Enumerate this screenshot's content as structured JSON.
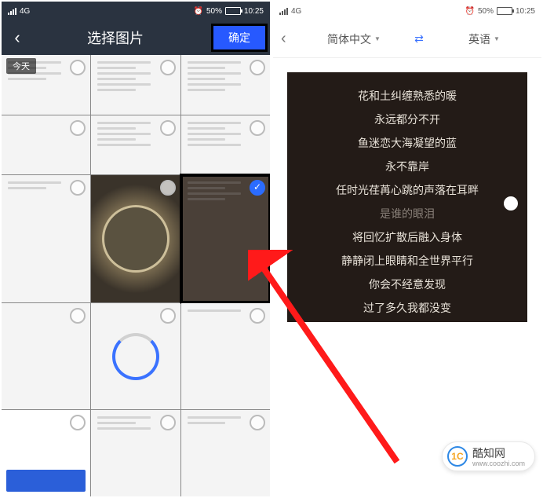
{
  "status": {
    "network": "4G",
    "battery_pct": "50%",
    "time": "10:25",
    "alarm_icon": "⏰"
  },
  "left": {
    "title": "选择图片",
    "confirm": "确定",
    "date_label": "今天",
    "thumb_selected_index": 7
  },
  "right": {
    "lang_from": "简体中文",
    "lang_to": "英语",
    "lyrics": [
      "花和土纠缠熟悉的暖",
      "永远都分不开",
      "鱼迷恋大海凝望的蓝",
      "永不靠岸",
      "任时光荏苒心跳的声落在耳畔",
      "是谁的眼泪",
      "将回忆扩散后融入身体",
      "静静闭上眼睛和全世界平行",
      "你会不经意发现",
      "过了多久我都没变"
    ],
    "dim_index": 5
  },
  "watermark": {
    "logo_text": "1C",
    "name": "酷知网",
    "url": "www.coozhi.com"
  }
}
